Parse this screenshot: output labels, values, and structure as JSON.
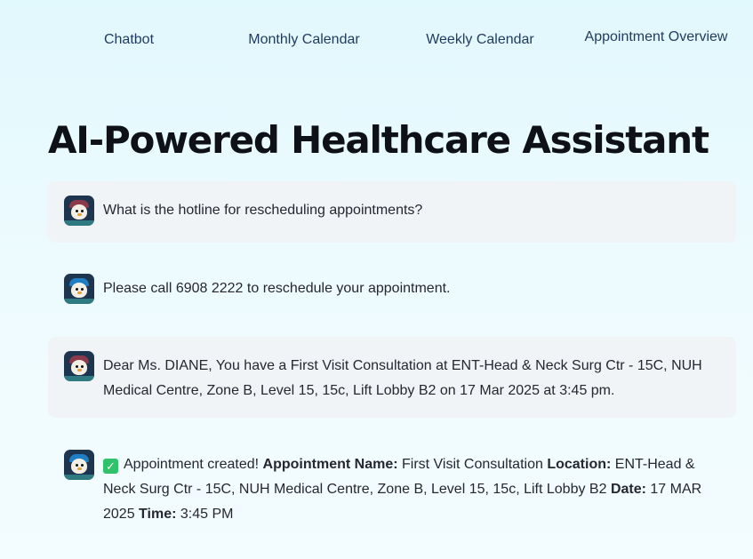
{
  "nav": {
    "tabs": [
      {
        "label": "Chatbot"
      },
      {
        "label": "Monthly Calendar"
      },
      {
        "label": "Weekly Calendar"
      },
      {
        "label": "Appointment Overview"
      }
    ]
  },
  "page": {
    "title": "AI-Powered Healthcare Assistant"
  },
  "messages": [
    {
      "role": "user",
      "text": "What is the hotline for rescheduling appointments?"
    },
    {
      "role": "assistant",
      "text": "Please call 6908 2222 to reschedule your appointment."
    },
    {
      "role": "user",
      "text": "Dear Ms. DIANE, You have a First Visit Consultation at ENT-Head & Neck Surg Ctr - 15C, NUH Medical Centre, Zone B, Level 15, 15c, Lift Lobby B2 on 17 Mar 2025 at 3:45 pm."
    },
    {
      "role": "assistant",
      "status": "Appointment created!",
      "name_label": "Appointment Name:",
      "name": "First Visit Consultation",
      "location_label": "Location:",
      "location": "ENT-Head & Neck Surg Ctr - 15C, NUH Medical Centre, Zone B, Level 15, 15c, Lift Lobby B2",
      "date_label": "Date:",
      "date": "17 MAR 2025",
      "time_label": "Time:",
      "time": "3:45 PM"
    }
  ],
  "icons": {
    "avatar_user": "user-avatar-icon",
    "avatar_bot": "bot-avatar-icon",
    "check": "check-mark-icon"
  },
  "colors": {
    "accent_check": "#2ec26a",
    "user_bubble": "#f0f4f7",
    "title": "#0e1117"
  }
}
